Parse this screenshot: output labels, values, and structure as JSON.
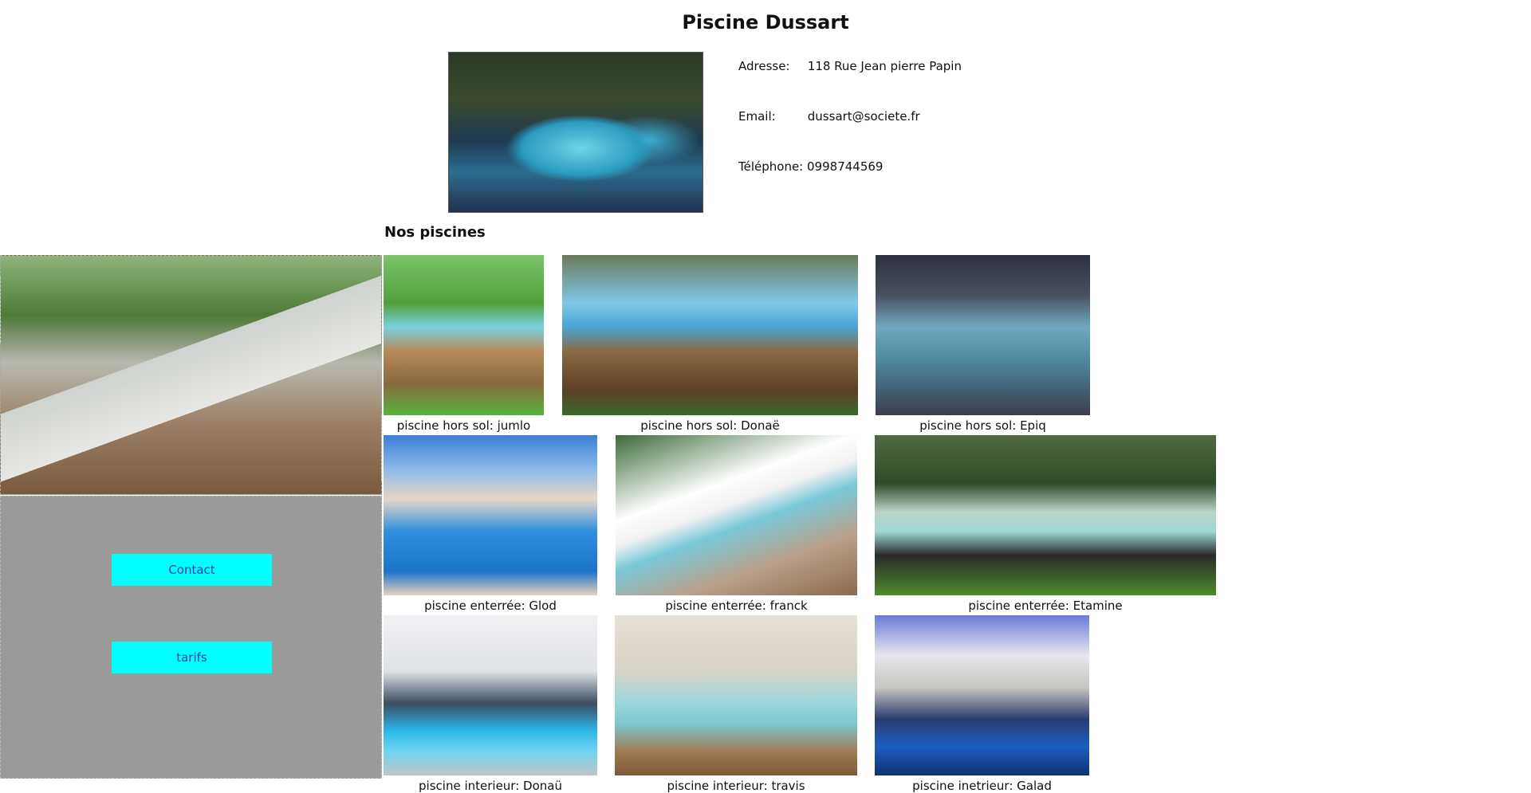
{
  "header": {
    "title": "Piscine Dussart"
  },
  "contact_info": {
    "address_label": "Adresse:",
    "address_value": "118 Rue Jean pierre Papin",
    "email_label": "Email:",
    "email_value": "dussart@societe.fr",
    "phone_label": "Téléphone:",
    "phone_value": "0998744569"
  },
  "section": {
    "title": "Nos piscines"
  },
  "sidebar": {
    "buttons": [
      {
        "label": "Contact"
      },
      {
        "label": "tarifs"
      }
    ]
  },
  "pools": [
    {
      "caption": "piscine hors sol: jumlo"
    },
    {
      "caption": "piscine hors sol: Donaë"
    },
    {
      "caption": "piscine hors sol: Epiq"
    },
    {
      "caption": "piscine enterrée: Glod"
    },
    {
      "caption": "piscine enterrée: franck"
    },
    {
      "caption": "piscine enterrée: Etamine"
    },
    {
      "caption": "piscine interieur: Donaü"
    },
    {
      "caption": "piscine interieur: travis"
    },
    {
      "caption": "piscine inetrieur: Galad"
    }
  ]
}
